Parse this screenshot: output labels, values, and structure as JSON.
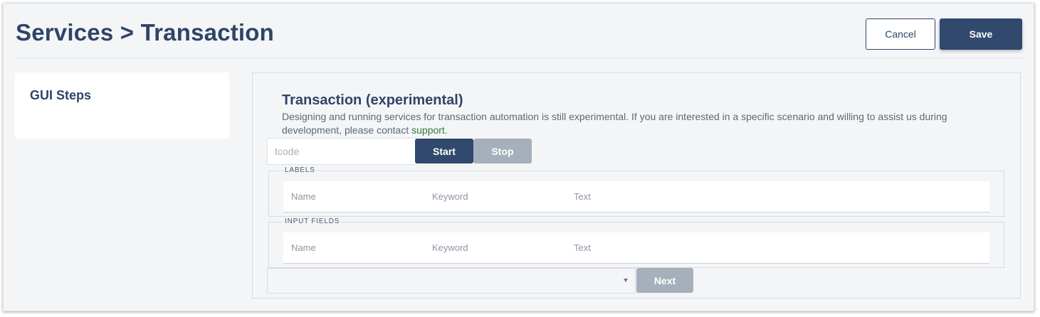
{
  "header": {
    "title": "Services > Transaction",
    "cancel_label": "Cancel",
    "save_label": "Save"
  },
  "sidebar": {
    "title": "GUI Steps"
  },
  "main": {
    "section_title": "Transaction (experimental)",
    "description_text": "Designing and running services for transaction automation is still experimental. If you are interested in a specific scenario and willing to assist us during development, please contact ",
    "support_link": "support",
    "description_end": ".",
    "tcode": {
      "placeholder": "tcode",
      "value": ""
    },
    "start_label": "Start",
    "stop_label": "Stop",
    "labels_section": {
      "legend": "LABELS",
      "columns": [
        "Name",
        "Keyword",
        "Text"
      ]
    },
    "input_fields_section": {
      "legend": "INPUT FIELDS",
      "columns": [
        "Name",
        "Keyword",
        "Text"
      ]
    },
    "select": {
      "value": ""
    },
    "next_label": "Next"
  },
  "colors": {
    "primary": "#30496c",
    "disabled": "#a6b0bc",
    "background": "#f4f5f7",
    "link": "#2f7a3a"
  }
}
